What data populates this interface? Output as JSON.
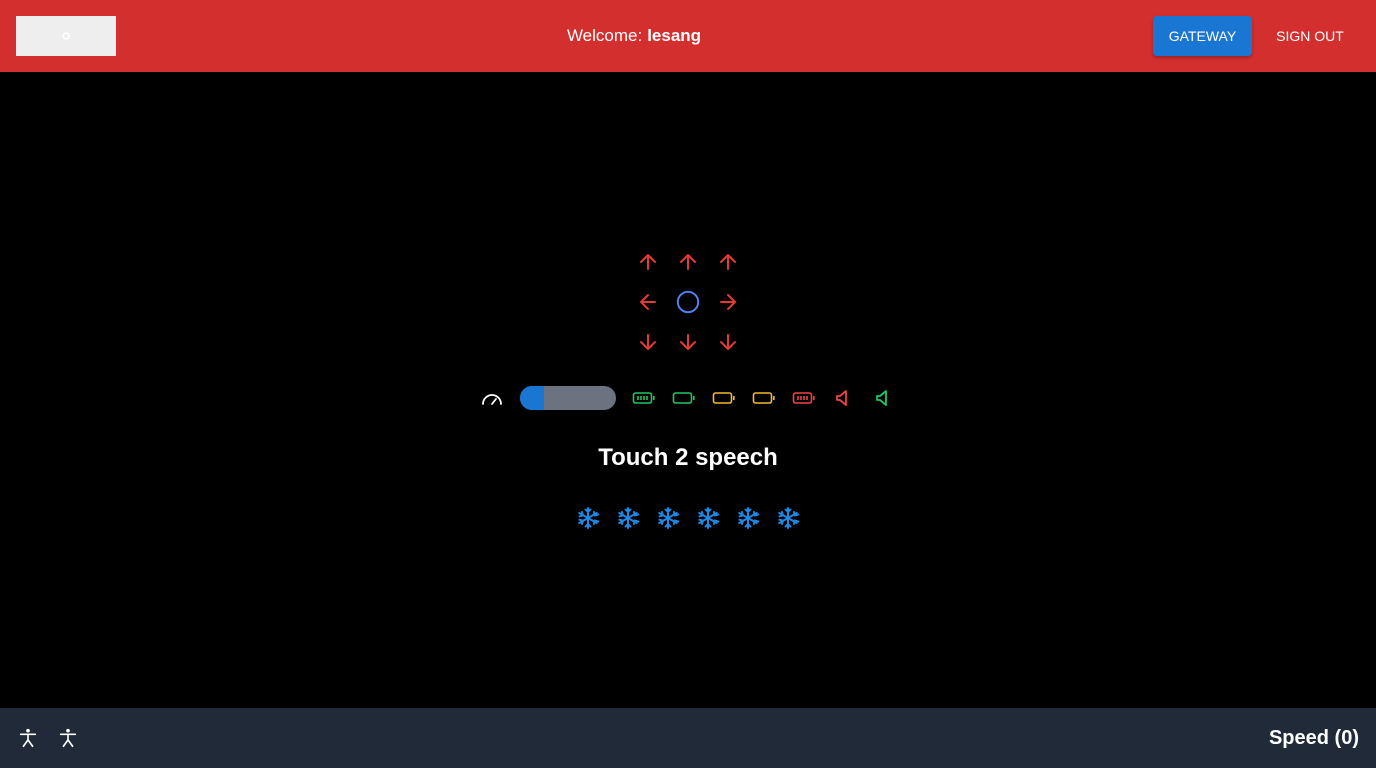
{
  "header": {
    "welcome_prefix": "Welcome:",
    "username": "lesang",
    "gateway_label": "GATEWAY",
    "signout_label": "SIGN OUT"
  },
  "controls": {
    "dpad_icons": [
      "arrow-up-left-icon",
      "arrow-up-icon",
      "arrow-up-right-icon",
      "arrow-left-icon",
      "circle-stop-icon",
      "arrow-right-icon",
      "arrow-down-left-icon",
      "arrow-down-icon",
      "arrow-down-right-icon"
    ],
    "slider_value_fraction": 0.25,
    "status_icons": [
      "speedometer-icon",
      "battery-full-green-icon",
      "battery-empty-green-icon",
      "battery-empty-yellow-icon",
      "battery-empty-yellow-icon",
      "battery-full-red-icon",
      "speaker-red-icon",
      "speaker-green-icon"
    ]
  },
  "main": {
    "title": "Touch 2 speech",
    "snowflake_count": 6
  },
  "footer": {
    "speed_label": "Speed (0)"
  },
  "colors": {
    "header": "#d32f2f",
    "accent_blue": "#1976d2",
    "arrow_red": "#e53935",
    "green": "#22c55e",
    "yellow": "#f5b731",
    "red": "#ef4444",
    "footer": "#212a38"
  }
}
